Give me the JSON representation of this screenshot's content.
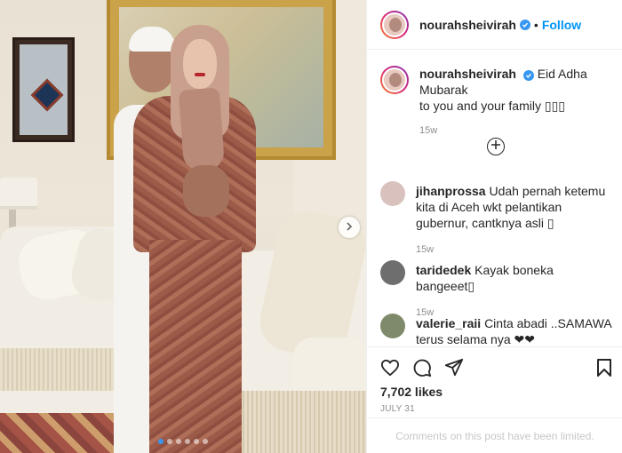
{
  "post": {
    "photo_alt": "",
    "carousel": {
      "dot_count": 6,
      "active_index": 0
    }
  },
  "header": {
    "username": "nourahsheivirah",
    "separator": "•",
    "follow_label": "Follow"
  },
  "caption": {
    "username": "nourahsheivirah",
    "text_line1": "Eid Adha Mubarak",
    "text_line2": "to you and your family ",
    "emoji": "▯▯▯",
    "time": "15w"
  },
  "comments": [
    {
      "username": "jihanprossa",
      "text": "Udah pernah ketemu kita di Aceh wkt pelantikan gubernur, cantknya asli ▯",
      "time": "15w",
      "avatar_color": "#d9c2bd"
    },
    {
      "username": "taridedek",
      "text": "Kayak boneka bangeeet▯",
      "time": "15w",
      "avatar_color": "#6e6e6e"
    },
    {
      "username": "valerie_raii",
      "text": "Cinta abadi ..SAMAWA terus selama nya ❤❤",
      "time": "",
      "avatar_color": "#7f8a6a"
    }
  ],
  "actions": {
    "likes": "7,702 likes",
    "date": "JULY 31"
  },
  "footer": {
    "limited_text": "Comments on this post have been limited."
  },
  "colors": {
    "link_blue": "#0095f6",
    "verified_blue": "#3897f0",
    "muted": "#8e8e8e"
  },
  "icons": [
    "next-chevron-icon",
    "verified-badge-icon",
    "plus-circle-icon",
    "heart-icon",
    "comment-icon",
    "share-icon",
    "bookmark-icon"
  ]
}
